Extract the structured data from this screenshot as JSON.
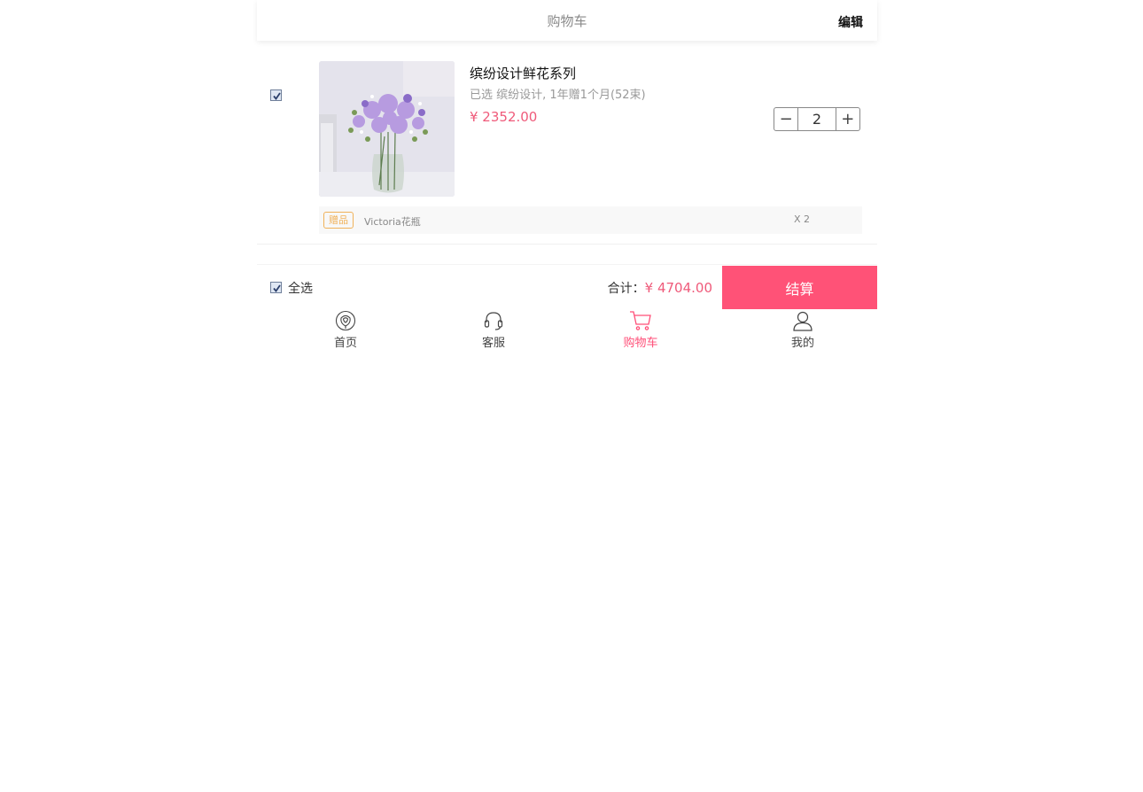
{
  "header": {
    "title": "购物车",
    "edit_label": "编辑"
  },
  "item": {
    "checked": true,
    "name": "缤纷设计鲜花系列",
    "spec": "已选 缤纷设计, 1年赠1个月(52束)",
    "price": "¥ 2352.00",
    "quantity": "2",
    "minus": "−",
    "plus": "+",
    "image_label": "flower-bouquet-photo"
  },
  "gift": {
    "tag": "赠品",
    "name": "Victoria花瓶",
    "count": "X 2"
  },
  "settle": {
    "select_all": "全选",
    "total_label": "合计：",
    "total_amount": "¥ 4704.00",
    "pay_label": "结算"
  },
  "tabbar": {
    "items": [
      {
        "label": "首页",
        "icon": "rose-icon"
      },
      {
        "label": "客服",
        "icon": "headset-icon"
      },
      {
        "label": "购物车",
        "icon": "cart-icon",
        "active": true
      },
      {
        "label": "我的",
        "icon": "user-icon"
      }
    ]
  },
  "colors": {
    "accent": "#ff5277",
    "price": "#ef5a7a",
    "gift_tag": "#f0b25a"
  }
}
